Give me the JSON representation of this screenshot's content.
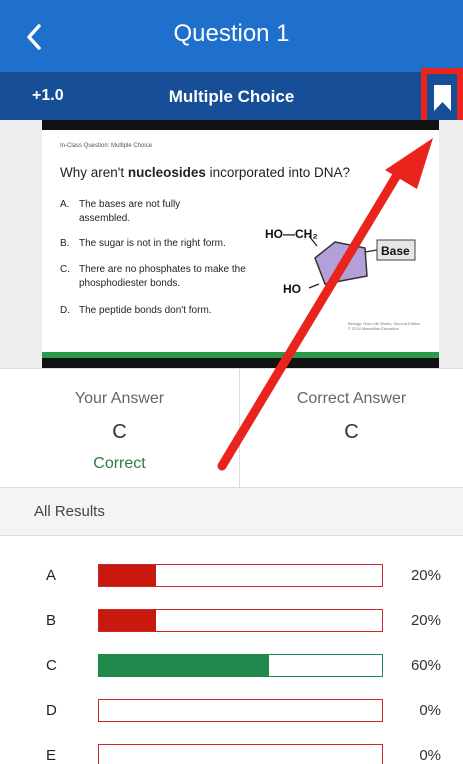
{
  "header": {
    "title": "Question 1"
  },
  "subheader": {
    "points": "+1.0",
    "question_type": "Multiple Choice"
  },
  "slide": {
    "label": "In-Class Question: Multiple Choice",
    "question_before": "Why aren't ",
    "question_bold": "nucleosides",
    "question_after": " incorporated into DNA?",
    "options": [
      {
        "letter": "A.",
        "text": "The bases are not fully assembled."
      },
      {
        "letter": "B.",
        "text": "The sugar is not in the right form."
      },
      {
        "letter": "C.",
        "text": "There are no phosphates to make the phosphodiester bonds."
      },
      {
        "letter": "D.",
        "text": "The peptide bonds don't form."
      }
    ],
    "diagram": {
      "top_label": "HO—CH₂",
      "left_label": "HO",
      "base_label": "Base"
    },
    "credit_line1": "Biology: How Life Works, Second Edition",
    "credit_line2": "© 2016 Macmillan Education"
  },
  "answers": {
    "your_label": "Your Answer",
    "your_value": "C",
    "status": "Correct",
    "correct_label": "Correct Answer",
    "correct_value": "C"
  },
  "results": {
    "title": "All Results",
    "rows": [
      {
        "letter": "A",
        "percent": "20%",
        "fraction": 0.2,
        "is_correct": false
      },
      {
        "letter": "B",
        "percent": "20%",
        "fraction": 0.2,
        "is_correct": false
      },
      {
        "letter": "C",
        "percent": "60%",
        "fraction": 0.6,
        "is_correct": true
      },
      {
        "letter": "D",
        "percent": "0%",
        "fraction": 0.0,
        "is_correct": false
      },
      {
        "letter": "E",
        "percent": "0%",
        "fraction": 0.0,
        "is_correct": false
      }
    ]
  },
  "colors": {
    "header_blue": "#1f6fcd",
    "subheader_blue": "#164f97",
    "annotation_red": "#e8241c",
    "wrong_bar": "#c9180d",
    "correct_bar": "#1f8a4c"
  },
  "icons": {
    "back": "chevron-left-icon",
    "bookmark": "bookmark-icon"
  }
}
